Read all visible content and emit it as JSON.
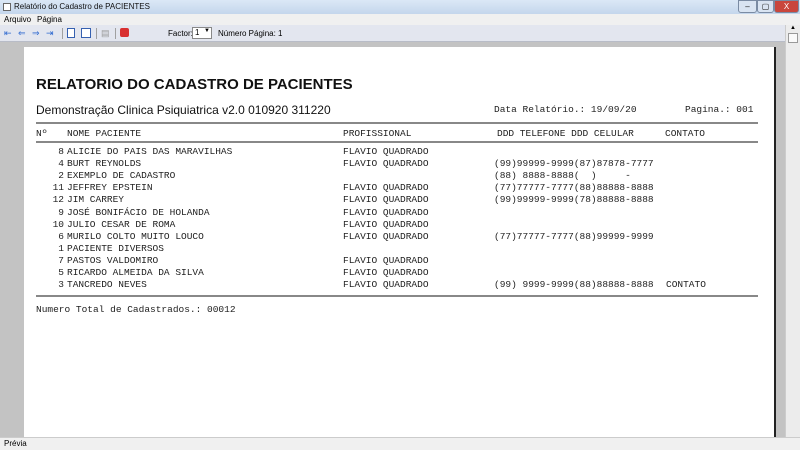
{
  "window": {
    "title": "Relatório do Cadastro de PACIENTES",
    "minimize": "–",
    "maximize": "▢",
    "close": "X"
  },
  "menu": [
    "Arquivo",
    "Página"
  ],
  "toolbar": {
    "factor_label": "Factor:",
    "factor_value": "1",
    "page_number": "Número Página: 1"
  },
  "report": {
    "title": "RELATORIO DO CADASTRO DE PACIENTES",
    "subtitle": "Demonstração Clinica Psiquiatrica v2.0 010920 311220",
    "date": "Data Relatório.: 19/09/20",
    "page": "Pagina.: 001",
    "headers": {
      "num": "Nº",
      "name": "NOME PACIENTE",
      "prof": "PROFISSIONAL",
      "phones": "DDD TELEFONE DDD CELULAR",
      "contact": "CONTATO"
    },
    "rows": [
      {
        "num": "8",
        "name": "ALICIE DO PAIS DAS MARAVILHAS",
        "prof": "FLAVIO QUADRADO",
        "phones": "",
        "contact": ""
      },
      {
        "num": "4",
        "name": "BURT REYNOLDS",
        "prof": "FLAVIO QUADRADO",
        "phones": "(99)99999-9999(87)87878-7777",
        "contact": ""
      },
      {
        "num": "2",
        "name": "EXEMPLO DE CADASTRO",
        "prof": "",
        "phones": "(88) 8888-8888(  )     -",
        "contact": ""
      },
      {
        "num": "11",
        "name": "JEFFREY EPSTEIN",
        "prof": "FLAVIO QUADRADO",
        "phones": "(77)77777-7777(88)88888-8888",
        "contact": ""
      },
      {
        "num": "12",
        "name": "JIM CARREY",
        "prof": "FLAVIO QUADRADO",
        "phones": "(99)99999-9999(78)88888-8888",
        "contact": ""
      },
      {
        "num": "9",
        "name": "JOSÉ BONIFÁCIO DE HOLANDA",
        "prof": "FLAVIO QUADRADO",
        "phones": "",
        "contact": ""
      },
      {
        "num": "10",
        "name": "JULIO CESAR DE ROMA",
        "prof": "FLAVIO QUADRADO",
        "phones": "",
        "contact": ""
      },
      {
        "num": "6",
        "name": "MURILO COLTO MUITO LOUCO",
        "prof": "FLAVIO QUADRADO",
        "phones": "(77)77777-7777(88)99999-9999",
        "contact": ""
      },
      {
        "num": "1",
        "name": "PACIENTE DIVERSOS",
        "prof": "",
        "phones": "",
        "contact": ""
      },
      {
        "num": "7",
        "name": "PASTOS VALDOMIRO",
        "prof": "FLAVIO QUADRADO",
        "phones": "",
        "contact": ""
      },
      {
        "num": "5",
        "name": "RICARDO ALMEIDA DA SILVA",
        "prof": "FLAVIO QUADRADO",
        "phones": "",
        "contact": ""
      },
      {
        "num": "3",
        "name": "TANCREDO NEVES",
        "prof": "FLAVIO QUADRADO",
        "phones": "(99) 9999-9999(88)88888-8888",
        "contact": "CONTATO"
      }
    ],
    "total": "Numero Total de Cadastrados.: 00012"
  },
  "status": "Prévia"
}
